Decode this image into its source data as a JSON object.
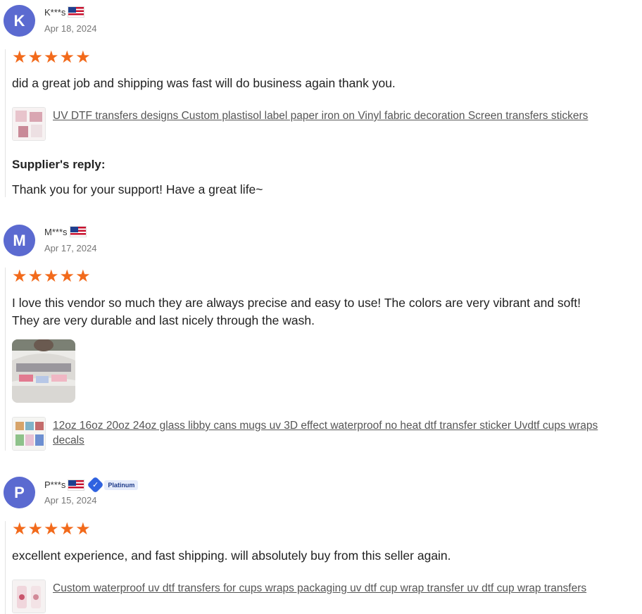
{
  "reviews": [
    {
      "initial": "K",
      "user": "K***s",
      "date": "Apr 18, 2024",
      "rating": 5,
      "text": "did a great job and shipping was fast will do business again thank you.",
      "product": "UV DTF transfers designs Custom plastisol label paper iron on Vinyl fabric decoration Screen transfers stickers",
      "reply_title": "Supplier's reply:",
      "reply_text": "Thank you for your support! Have a great life~"
    },
    {
      "initial": "M",
      "user": "M***s",
      "date": "Apr 17, 2024",
      "rating": 5,
      "text_line1": "I love this vendor so much they are always precise and easy to use! The colors are very vibrant and soft!",
      "text_line2": "They are very durable and last nicely through the wash.",
      "product": "12oz 16oz 20oz 24oz glass libby cans mugs uv 3D effect waterproof no heat dtf transfer sticker Uvdtf cups wraps decals"
    },
    {
      "initial": "P",
      "user": "P***s",
      "badge": "Platinum",
      "date": "Apr 15, 2024",
      "rating": 5,
      "text": "excellent experience, and fast shipping. will absolutely buy from this seller again.",
      "product": "Custom waterproof uv dtf transfers for cups wraps packaging uv dtf cup wrap transfer uv dtf cup wrap transfers"
    }
  ],
  "icons": {
    "star": "★",
    "flag": "us-flag-icon",
    "badge": "verified-shield-icon"
  },
  "colors": {
    "avatar": "#5b6ad0",
    "star": "#f26a1b",
    "link": "#555555",
    "badge": "#2f62e0"
  }
}
